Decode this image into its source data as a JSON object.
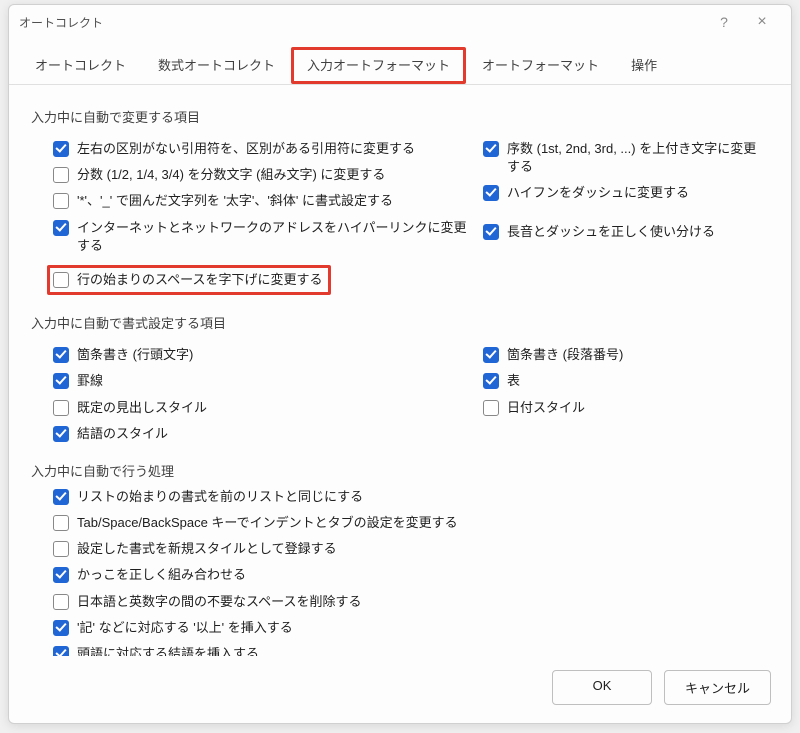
{
  "titlebar": {
    "title": "オートコレクト",
    "help": "?",
    "close": "×"
  },
  "tabs": [
    {
      "label": "オートコレクト",
      "active": false
    },
    {
      "label": "数式オートコレクト",
      "active": false
    },
    {
      "label": "入力オートフォーマット",
      "active": true
    },
    {
      "label": "オートフォーマット",
      "active": false
    },
    {
      "label": "操作",
      "active": false
    }
  ],
  "section1": {
    "label": "入力中に自動で変更する項目",
    "left": [
      {
        "label": "左右の区別がない引用符を、区別がある引用符に変更する",
        "checked": true
      },
      {
        "label": "分数 (1/2, 1/4, 3/4) を分数文字 (組み文字) に変更する",
        "checked": false
      },
      {
        "label": "'*'、'_' で囲んだ文字列を '太字'、'斜体' に書式設定する",
        "checked": false
      },
      {
        "label": "インターネットとネットワークのアドレスをハイパーリンクに変更する",
        "checked": true
      },
      {
        "label": "行の始まりのスペースを字下げに変更する",
        "checked": false
      }
    ],
    "right": [
      {
        "label": "序数 (1st, 2nd, 3rd, ...) を上付き文字に変更する",
        "checked": true
      },
      {
        "label": "ハイフンをダッシュに変更する",
        "checked": true
      },
      {
        "label": "長音とダッシュを正しく使い分ける",
        "checked": true
      }
    ]
  },
  "section2": {
    "label": "入力中に自動で書式設定する項目",
    "left": [
      {
        "label": "箇条書き (行頭文字)",
        "checked": true
      },
      {
        "label": "罫線",
        "checked": true
      },
      {
        "label": "既定の見出しスタイル",
        "checked": false
      },
      {
        "label": "結語のスタイル",
        "checked": true
      }
    ],
    "right": [
      {
        "label": "箇条書き (段落番号)",
        "checked": true
      },
      {
        "label": "表",
        "checked": true
      },
      {
        "label": "日付スタイル",
        "checked": false
      }
    ]
  },
  "section3": {
    "label": "入力中に自動で行う処理",
    "items": [
      {
        "label": "リストの始まりの書式を前のリストと同じにする",
        "checked": true
      },
      {
        "label": "Tab/Space/BackSpace キーでインデントとタブの設定を変更する",
        "checked": false
      },
      {
        "label": "設定した書式を新規スタイルとして登録する",
        "checked": false
      },
      {
        "label": "かっこを正しく組み合わせる",
        "checked": true
      },
      {
        "label": "日本語と英数字の間の不要なスペースを削除する",
        "checked": false
      },
      {
        "label": "'記' などに対応する '以上' を挿入する",
        "checked": true
      },
      {
        "label": "頭語に対応する結語を挿入する",
        "checked": true
      }
    ]
  },
  "footer": {
    "ok": "OK",
    "cancel": "キャンセル"
  }
}
